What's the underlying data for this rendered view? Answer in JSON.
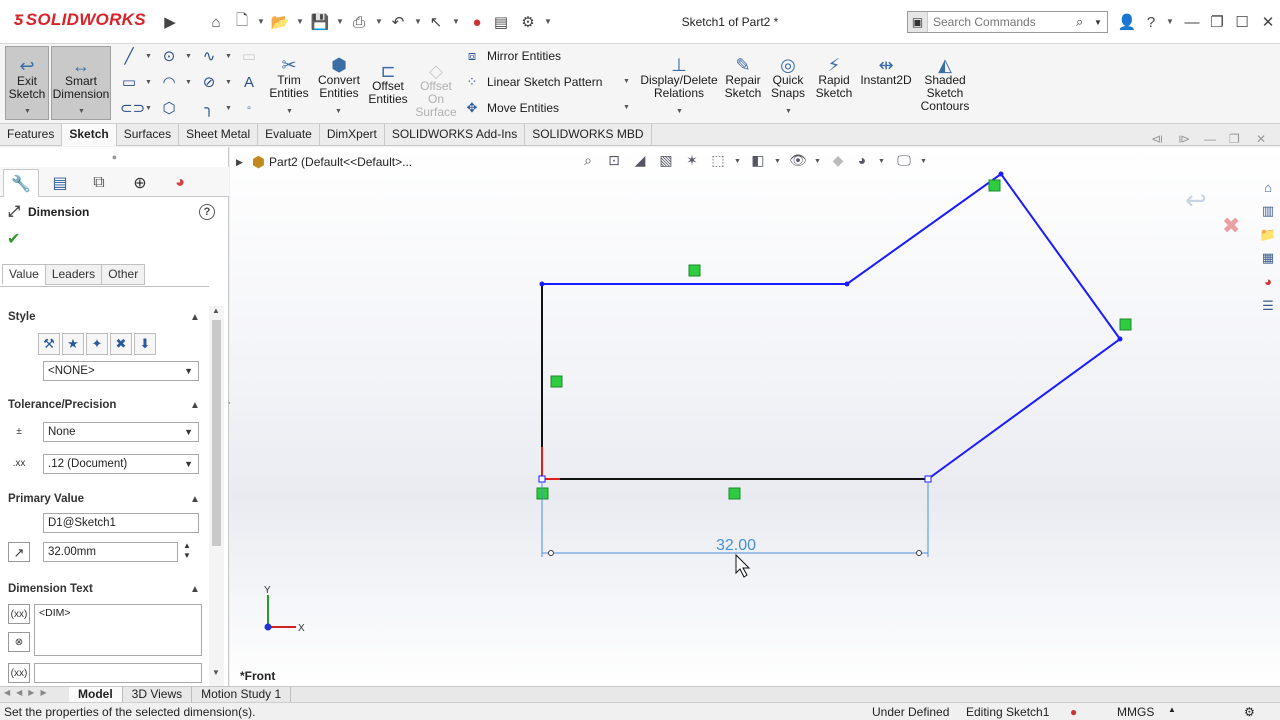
{
  "app": {
    "logo_text": "SOLIDWORKS",
    "doc_title": "Sketch1 of Part2 *",
    "search_placeholder": "Search Commands"
  },
  "command_manager": {
    "exit_sketch": "Exit Sketch",
    "smart_dimension": "Smart Dimension",
    "trim_entities": "Trim Entities",
    "convert_entities": "Convert Entities",
    "offset_entities": "Offset Entities",
    "offset_on_surface": "Offset On Surface",
    "mirror_entities": "Mirror Entities",
    "linear_sketch_pattern": "Linear Sketch Pattern",
    "move_entities": "Move Entities",
    "display_delete_relations": "Display/Delete Relations",
    "repair_sketch": "Repair Sketch",
    "quick_snaps": "Quick Snaps",
    "rapid_sketch": "Rapid Sketch",
    "instant2d": "Instant2D",
    "shaded_sketch_contours": "Shaded Sketch Contours"
  },
  "tabs": [
    "Features",
    "Sketch",
    "Surfaces",
    "Sheet Metal",
    "Evaluate",
    "DimXpert",
    "SOLIDWORKS Add-Ins",
    "SOLIDWORKS MBD"
  ],
  "active_tab": "Sketch",
  "property_manager": {
    "title": "Dimension",
    "help": "?",
    "subtabs": [
      "Value",
      "Leaders",
      "Other"
    ],
    "style": {
      "title": "Style",
      "selected": "<NONE>"
    },
    "tolerance": {
      "title": "Tolerance/Precision",
      "tolerance_type": "None",
      "precision": ".12 (Document)"
    },
    "primary_value": {
      "title": "Primary Value",
      "name": "D1@Sketch1",
      "value": "32.00mm"
    },
    "dimension_text": {
      "title": "Dimension Text",
      "text": "<DIM>"
    }
  },
  "graphics": {
    "tree_flyout": "Part2  (Default<<Default>...",
    "dimension_value": "32.00",
    "view_label": "*Front",
    "axis_x": "X",
    "axis_y": "Y"
  },
  "bottom_tabs": [
    "Model",
    "3D Views",
    "Motion Study 1"
  ],
  "active_bottom_tab": "Model",
  "status": {
    "message": "Set the properties of the selected dimension(s).",
    "sketch_state": "Under Defined",
    "editing": "Editing Sketch1",
    "units": "MMGS"
  },
  "colors": {
    "sketch_blue": "#1a1aff",
    "relation_green": "#2ecc40",
    "dimension_blue": "#4a90d9",
    "logo_red": "#d8232a"
  }
}
